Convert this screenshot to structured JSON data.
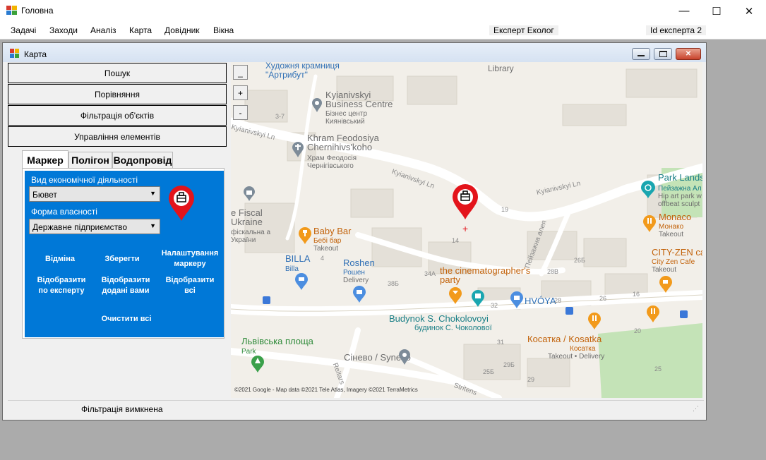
{
  "app": {
    "title": "Головна",
    "caption_min": "—",
    "caption_max": "☐",
    "caption_close": "✕"
  },
  "menu": {
    "items": [
      "Задачі",
      "Заходи",
      "Аналіз",
      "Карта",
      "Довідник",
      "Вікна"
    ],
    "expert_role": "Експерт Еколог",
    "expert_id": "Id експерта 2"
  },
  "child_window": {
    "title": "Карта"
  },
  "sidebar": {
    "buttons": [
      "Пошук",
      "Порівняння",
      "Фільтрація об'єктів",
      "Управління елементів"
    ]
  },
  "tabs": [
    "Маркер",
    "Полігон",
    "Водопровід"
  ],
  "marker_panel": {
    "activity_label": "Вид економічної діяльності",
    "activity_value": "Бювет",
    "ownership_label": "Форма власності",
    "ownership_value": "Державне підприємство",
    "buttons": {
      "cancel": "Відміна",
      "save": "Зберегти",
      "settings": "Налаштування маркеру",
      "show_by_expert": "Відобразити по експерту",
      "show_added": "Відобразити додані вами",
      "show_all": "Відобразити всі",
      "clear_all": "Очистити всі"
    }
  },
  "map": {
    "controls": [
      "_",
      "+",
      "-"
    ],
    "attribution": "©2021 Google - Map data ©2021 Tele Atlas, Imagery ©2021 TerraMetrics",
    "pois": {
      "art_shop": "Художня крамниця \"Артрибут\"",
      "library": "Library",
      "kbc_en": "Kyianivskyi Business Centre",
      "kbc_uk": "Бізнес центр Киянівський",
      "church_en": "Khram Feodosiya Chernihivs'koho",
      "church_uk": "Храм Феодосія Чернігівського",
      "park_lands": "Park Lands",
      "park_lands_uk": "Пейзажна Ал",
      "park_lands_en": "Hip art park w offbeat sculpt",
      "fiscal": "e Fiscal Ukraine",
      "fiscal_uk": "фіскальна а України",
      "baby_bar": "Baby Bar",
      "baby_bar_uk": "Бебі бар",
      "baby_bar_sub": "Takeout",
      "monaco": "Monaco",
      "monaco_uk": "Монако",
      "monaco_sub": "Takeout",
      "billa": "BILLA",
      "billa_sub": "Billa",
      "roshen": "Roshen",
      "roshen_uk": "Рошен",
      "roshen_sub": "Delivery",
      "cinema_party": "the cinematographer's party",
      "city_zen": "CITY-ZEN ca",
      "city_zen_sub": "City Zen Cafe",
      "city_zen_sub2": "Takeout",
      "hvoya": "HVÓYA",
      "budynok_en": "Budynok S. Chokolovoyi",
      "budynok_uk": "будинок С. Чоколової",
      "square": "Львівська площа",
      "square_sub": "Park",
      "kosatka": "Косатка / Kosatka",
      "kosatka_uk": "Косатка",
      "kosatka_sub": "Takeout • Delivery",
      "sinevo": "Сінево / Synevo"
    },
    "streets": {
      "kyianivskyi_1": "Kyianivskyi Ln",
      "kyianivskyi_2": "Kyianivskyi Ln",
      "kyianivskyi_3": "Kyianivskyi Ln",
      "peizazhna": "Пейзажна алея",
      "stritenska": "Stritens",
      "reitarska": "Reitars"
    },
    "numbers": {
      "n37": "3-7",
      "n19": "19",
      "n14": "14",
      "n4": "4",
      "n34a": "34А",
      "n28v": "28В",
      "n26b": "26Б",
      "n38b": "38Б",
      "n32": "32",
      "n28": "28",
      "n26": "26",
      "n16": "16",
      "n31": "31",
      "n29b": "29Б",
      "n25b": "25Б",
      "n29": "29",
      "n25": "25",
      "n20": "20"
    }
  },
  "status": {
    "text": "Фільтрація вимкнена"
  }
}
